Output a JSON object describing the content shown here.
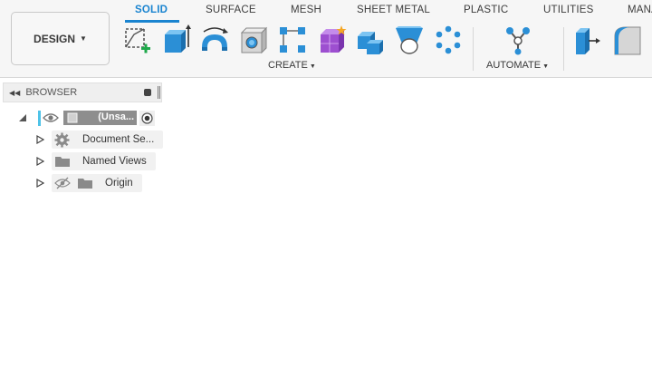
{
  "workspace": {
    "label": "DESIGN"
  },
  "tabs": [
    {
      "label": "SOLID",
      "active": true
    },
    {
      "label": "SURFACE"
    },
    {
      "label": "MESH"
    },
    {
      "label": "SHEET METAL"
    },
    {
      "label": "PLASTIC"
    },
    {
      "label": "UTILITIES"
    },
    {
      "label": "MANA"
    }
  ],
  "groups": {
    "create": {
      "label": "CREATE"
    },
    "automate": {
      "label": "AUTOMATE"
    }
  },
  "tools": [
    {
      "name": "create-sketch-icon"
    },
    {
      "name": "extrude-icon"
    },
    {
      "name": "revolve-icon"
    },
    {
      "name": "hole-icon"
    },
    {
      "name": "rectangular-pattern-icon"
    },
    {
      "name": "create-form-icon"
    },
    {
      "name": "combine-icon"
    },
    {
      "name": "loft-icon"
    },
    {
      "name": "circular-pattern-icon"
    },
    {
      "name": "automate-icon"
    },
    {
      "name": "press-pull-icon"
    },
    {
      "name": "fillet-icon"
    }
  ],
  "browser": {
    "title": "BROWSER",
    "root": {
      "label": "(Unsa..."
    },
    "nodes": [
      {
        "label": "Document Se...",
        "icon": "gear-icon"
      },
      {
        "label": "Named Views",
        "icon": "folder-icon"
      },
      {
        "label": "Origin",
        "icon": "folder-icon",
        "hidden_icon": "eye-hidden-icon"
      }
    ]
  },
  "colors": {
    "accent": "#1a84d0",
    "active_marker": "#4fc3e8",
    "root_label_bg": "#8e8e8e"
  }
}
